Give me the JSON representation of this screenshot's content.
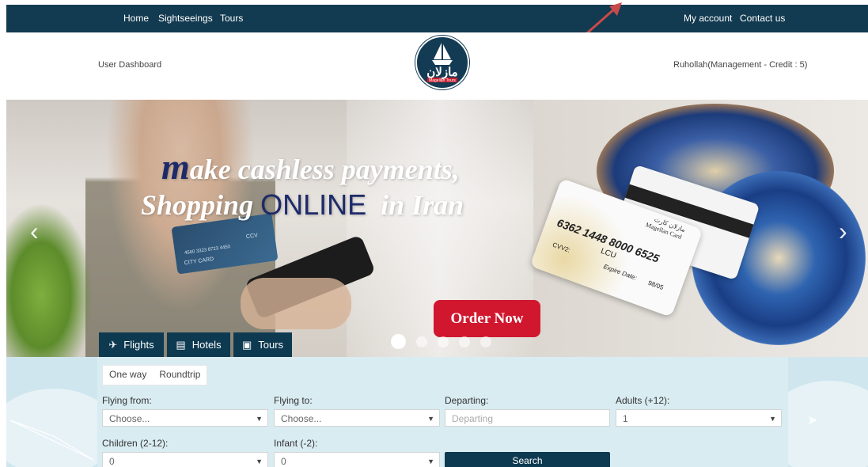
{
  "topnav": {
    "left_links": [
      "Home",
      "Sightseeings",
      "Tours"
    ],
    "right_links": [
      "My account",
      "Contact us"
    ],
    "bg_color": "#123a50"
  },
  "header": {
    "dashboard_label": "User Dashboard",
    "user_label": "Ruhollah(Management - Credit : 5)",
    "logo_text": "مازلان",
    "logo_subtext": "Magellan Tours"
  },
  "hero": {
    "slogan_line1_cap": "m",
    "slogan_line1_rest": "ake cashless payments,",
    "slogan_line2_a": "Shopping",
    "slogan_line2_b": "ONLINE",
    "slogan_line2_c": "in  Iran",
    "order_button": "Order Now",
    "card_number": "6362 1448 8000 6525",
    "card_lcu": "LCU",
    "card_cvv": "CVV2:",
    "card_expire": "Expire Date:",
    "card_expire_value": "98/05",
    "card_brand": "Magellan Card",
    "card_brand_fa": "مازلان کارت",
    "phone_card_ccv": "CCV",
    "phone_card_numbers": "4560 3323 8723 4450",
    "phone_card_label": "CITY CARD",
    "prev_icon": "chevron-left-icon",
    "next_icon": "chevron-right-icon",
    "slide_count": 5,
    "active_slide": 1,
    "accent_color": "#d0172e"
  },
  "tabs": [
    {
      "label": "Flights",
      "icon": "plane-icon"
    },
    {
      "label": "Hotels",
      "icon": "building-icon"
    },
    {
      "label": "Tours",
      "icon": "suitcase-icon"
    }
  ],
  "search": {
    "trip_types": [
      "One way",
      "Roundtrip"
    ],
    "flying_from_label": "Flying from:",
    "flying_from_value": "Choose...",
    "flying_to_label": "Flying to:",
    "flying_to_value": "Choose...",
    "departing_label": "Departing:",
    "departing_placeholder": "Departing",
    "adults_label": "Adults (+12):",
    "adults_value": "1",
    "children_label": "Children (2-12):",
    "children_value": "0",
    "infant_label": "Infant (-2):",
    "infant_value": "0",
    "search_button": "Search"
  }
}
